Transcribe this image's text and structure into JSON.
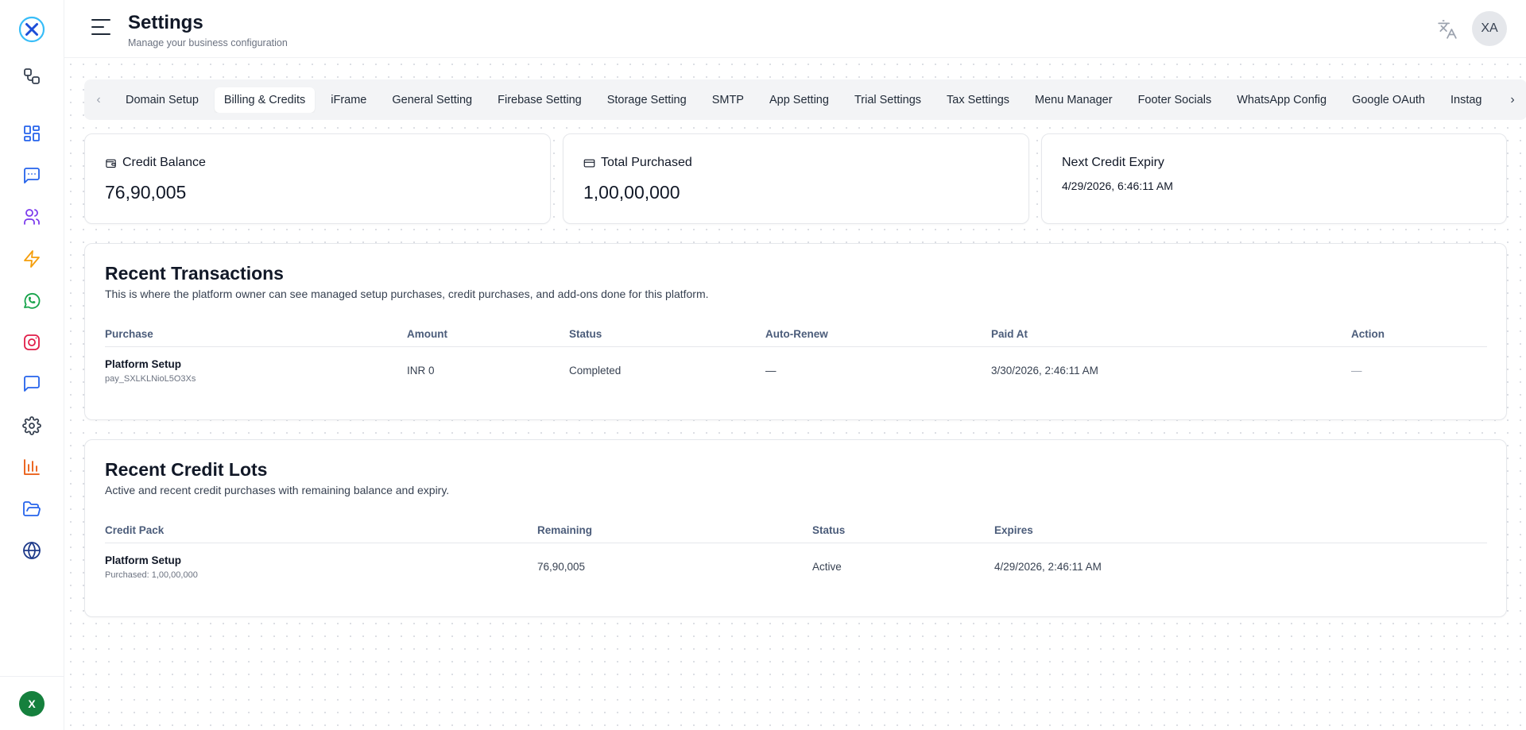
{
  "header": {
    "title": "Settings",
    "subtitle": "Manage your business configuration",
    "avatar_initials": "XA"
  },
  "sidebar": {
    "footer_avatar": "X",
    "items": [
      {
        "icon": "workflow-icon",
        "color": "#374151"
      },
      {
        "icon": "dashboard-icon",
        "color": "#2563eb"
      },
      {
        "icon": "message-icon",
        "color": "#2563eb"
      },
      {
        "icon": "users-icon",
        "color": "#7c3aed"
      },
      {
        "icon": "zap-icon",
        "color": "#f59e0b"
      },
      {
        "icon": "whatsapp-icon",
        "color": "#16a34a"
      },
      {
        "icon": "instagram-icon",
        "color": "#e11d48"
      },
      {
        "icon": "chat-icon",
        "color": "#2563eb"
      },
      {
        "icon": "gear-icon",
        "color": "#374151"
      },
      {
        "icon": "bar-chart-icon",
        "color": "#ea580c"
      },
      {
        "icon": "folder-icon",
        "color": "#2563eb"
      },
      {
        "icon": "globe-icon",
        "color": "#1e3a8a"
      }
    ]
  },
  "tabs": [
    {
      "label": "Domain Setup"
    },
    {
      "label": "Billing & Credits",
      "active": true
    },
    {
      "label": "iFrame"
    },
    {
      "label": "General Setting"
    },
    {
      "label": "Firebase Setting"
    },
    {
      "label": "Storage Setting"
    },
    {
      "label": "SMTP"
    },
    {
      "label": "App Setting"
    },
    {
      "label": "Trial Settings"
    },
    {
      "label": "Tax Settings"
    },
    {
      "label": "Menu Manager"
    },
    {
      "label": "Footer Socials"
    },
    {
      "label": "WhatsApp Config"
    },
    {
      "label": "Google OAuth"
    },
    {
      "label": "Instag"
    }
  ],
  "stats": {
    "credit_balance": {
      "label": "Credit Balance",
      "value": "76,90,005"
    },
    "total_purchased": {
      "label": "Total Purchased",
      "value": "1,00,00,000"
    },
    "next_expiry": {
      "label": "Next Credit Expiry",
      "value": "4/29/2026, 6:46:11 AM"
    }
  },
  "transactions": {
    "title": "Recent Transactions",
    "description": "This is where the platform owner can see managed setup purchases, credit purchases, and add-ons done for this platform.",
    "columns": [
      "Purchase",
      "Amount",
      "Status",
      "Auto-Renew",
      "Paid At",
      "Action"
    ],
    "rows": [
      {
        "purchase": "Platform Setup",
        "purchase_id": "pay_SXLKLNioL5O3Xs",
        "amount": "INR 0",
        "status": "Completed",
        "auto_renew": "—",
        "paid_at": "3/30/2026, 2:46:11 AM",
        "action": "—"
      }
    ]
  },
  "credit_lots": {
    "title": "Recent Credit Lots",
    "description": "Active and recent credit purchases with remaining balance and expiry.",
    "columns": [
      "Credit Pack",
      "Remaining",
      "Status",
      "Expires"
    ],
    "rows": [
      {
        "pack": "Platform Setup",
        "purchased": "Purchased: 1,00,00,000",
        "remaining": "76,90,005",
        "status": "Active",
        "expires": "4/29/2026, 2:46:11 AM"
      }
    ]
  }
}
